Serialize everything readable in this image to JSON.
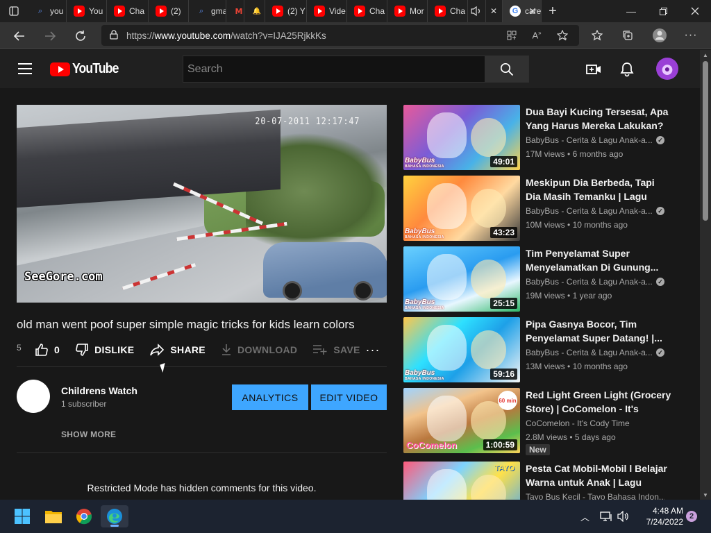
{
  "browser": {
    "tabs": [
      {
        "label": "you",
        "favicon": "search-icon"
      },
      {
        "label": "You",
        "favicon": "youtube-icon"
      },
      {
        "label": "Cha",
        "favicon": "youtube-icon"
      },
      {
        "label": "(2)",
        "favicon": "youtube-icon"
      },
      {
        "label": "gma",
        "favicon": "search-icon"
      },
      {
        "label": "",
        "favicon": "gmail-icon"
      },
      {
        "label": "",
        "favicon": "bell-icon"
      },
      {
        "label": "(2) Y",
        "favicon": "youtube-icon"
      },
      {
        "label": "Vide",
        "favicon": "youtube-icon"
      },
      {
        "label": "Cha",
        "favicon": "youtube-icon"
      },
      {
        "label": "Mor",
        "favicon": "youtube-icon"
      },
      {
        "label": "Cha",
        "favicon": "youtube-icon"
      }
    ],
    "active_tab": {
      "label": "care",
      "favicon": "google-icon"
    },
    "url_prefix": "https://",
    "url_host": "www.youtube.com",
    "url_path": "/watch?v=IJA25RjkkKs"
  },
  "youtube": {
    "logo_text": "YouTube",
    "search_placeholder": "Search",
    "video": {
      "title": "old man went poof super simple magic tricks for kids learn colors",
      "views_stub": "5",
      "like_count": "0",
      "dislike_label": "DISLIKE",
      "share_label": "SHARE",
      "download_label": "DOWNLOAD",
      "save_label": "SAVE",
      "overlay_date": "20-07-2011 12:17:47",
      "watermark": "SeeGore.com"
    },
    "channel": {
      "name": "Childrens Watch",
      "subscribers": "1 subscriber",
      "analytics_label": "ANALYTICS",
      "edit_label": "EDIT VIDEO",
      "show_more": "SHOW MORE"
    },
    "comments_notice": "Restricted Mode has hidden comments for this video.",
    "recommendations": [
      {
        "title": "Dua Bayi Kucing Tersesat, Apa Yang Harus Mereka Lakukan? ...",
        "channel": "BabyBus - Cerita & Lagu Anak-a...",
        "verified": true,
        "views": "17M views",
        "age": "6 months ago",
        "duration": "49:01",
        "new": false
      },
      {
        "title": "Meskipun Dia Berbeda, Tapi Dia Masih Temanku | Lagu Anak...",
        "channel": "BabyBus - Cerita & Lagu Anak-a...",
        "verified": true,
        "views": "10M views",
        "age": "10 months ago",
        "duration": "43:23",
        "new": false
      },
      {
        "title": "Tim Penyelamat Super Menyelamatkan Di Gunung...",
        "channel": "BabyBus - Cerita & Lagu Anak-a...",
        "verified": true,
        "views": "19M views",
        "age": "1 year ago",
        "duration": "25:15",
        "new": false
      },
      {
        "title": "Pipa Gasnya Bocor, Tim Penyelamat Super Datang! |...",
        "channel": "BabyBus - Cerita & Lagu Anak-a...",
        "verified": true,
        "views": "13M views",
        "age": "10 months ago",
        "duration": "59:16",
        "new": false
      },
      {
        "title": "Red Light Green Light (Grocery Store) | CoComelon - It's Cody...",
        "channel": "CoComelon - It's Cody Time",
        "verified": false,
        "views": "2.8M views",
        "age": "5 days ago",
        "duration": "1:00:59",
        "new": true,
        "new_label": "New"
      },
      {
        "title": "Pesta Cat Mobil-Mobil l Belajar Warna untuk Anak | Lagu Anak...",
        "channel": "Tayo Bus Kecil - Tayo Bahasa Indon...",
        "verified": false,
        "views": "",
        "age": "",
        "duration": "",
        "new": false
      }
    ],
    "thumb_brand": "BabyBus",
    "thumb_brand_sub": "BAHASA INDONESIA",
    "cocomelon_brand": "CoComelon",
    "cocomelon_badge": "60 min",
    "tayo_brand": "TAYO"
  },
  "taskbar": {
    "time": "4:48 AM",
    "date": "7/24/2022",
    "notifications": "2"
  },
  "colors": {
    "yt_bg": "#181818",
    "accent_blue": "#3ea6ff",
    "yt_red": "#ff0000"
  }
}
